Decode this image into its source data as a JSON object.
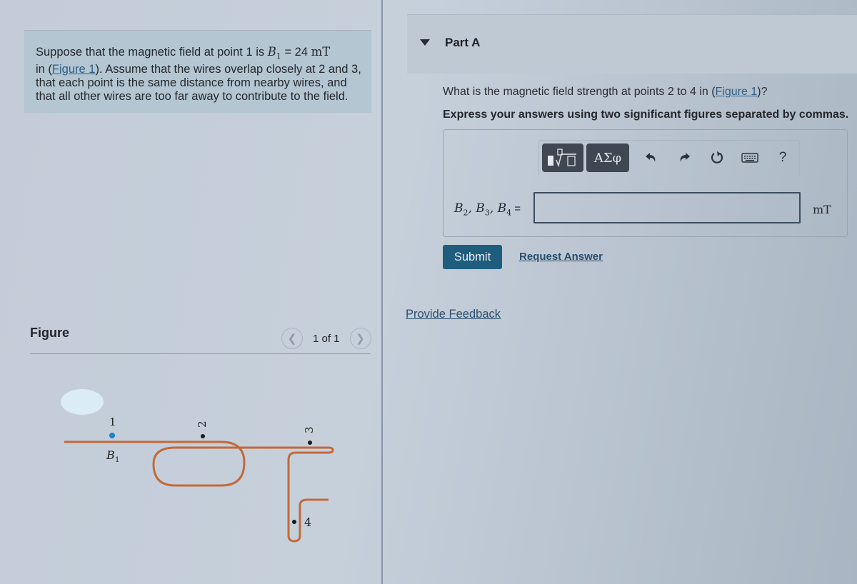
{
  "problem": {
    "text_before": "Suppose that the magnetic field at point 1 is ",
    "b1_symbol": "B",
    "b1_subscript": "1",
    "b1_equals": " = 24 ",
    "b1_unit": "mT",
    "line2_prefix": "in (",
    "figure_link": "Figure 1",
    "line2_suffix": "). Assume that the wires overlap closely at 2 and 3, that each point is the same distance from nearby wires, and that all other wires are too far away to contribute to the field."
  },
  "figure": {
    "header": "Figure",
    "prev_icon": "chevron-left-icon",
    "next_icon": "chevron-right-icon",
    "counter": "1 of 1",
    "labels": {
      "p1": "1",
      "p2": "2",
      "p3": "3",
      "p4": "4",
      "b1": "B",
      "b1_sub": "1"
    },
    "colors": {
      "wire": "#c2693a",
      "point1": "#1b84c8",
      "point_other": "#1a1a1a"
    }
  },
  "part": {
    "caret_icon": "caret-down-icon",
    "title": "Part A",
    "question_prefix": "What is the magnetic field strength at points 2 to 4 in (",
    "question_link": "Figure 1",
    "question_suffix": ")?",
    "instruction": "Express your answers using two significant figures separated by commas."
  },
  "toolbar": {
    "templates_icon": "templates-icon",
    "greek_label": "ΑΣφ",
    "undo_icon": "undo-icon",
    "redo_icon": "redo-icon",
    "reset_icon": "reset-icon",
    "keyboard_icon": "keyboard-icon",
    "help_label": "?"
  },
  "answer": {
    "label_parts": [
      "B",
      "2",
      ", B",
      "3",
      ", B",
      "4",
      " ="
    ],
    "value": "",
    "unit": "mT"
  },
  "actions": {
    "submit": "Submit",
    "request_answer": "Request Answer",
    "provide_feedback": "Provide Feedback"
  }
}
